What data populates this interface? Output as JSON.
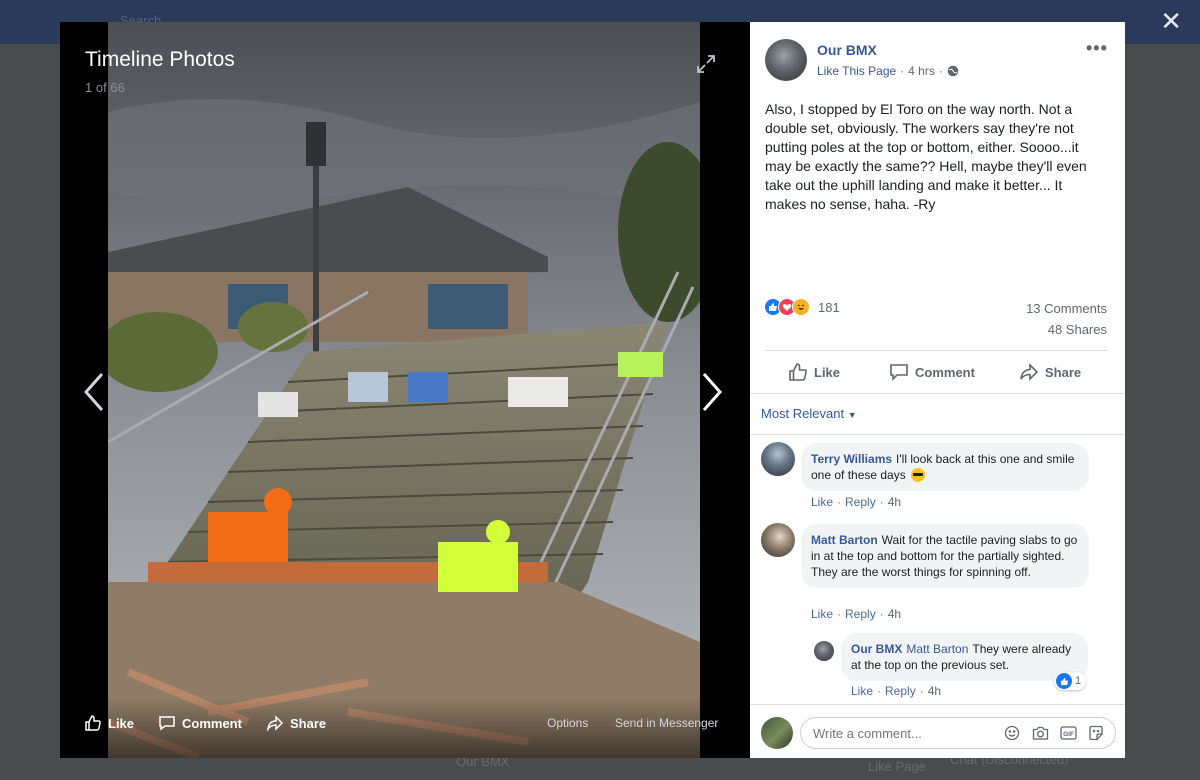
{
  "background": {
    "search_placeholder": "Search",
    "ghost_page_name": "Our BMX",
    "ghost_like_page": "Like Page",
    "ghost_chat": "Chat (Disconnected)"
  },
  "viewer": {
    "title": "Timeline Photos",
    "counter": "1 of 66",
    "actions": {
      "like": "Like",
      "comment": "Comment",
      "share": "Share"
    },
    "links": {
      "options": "Options",
      "send": "Send in Messenger"
    }
  },
  "post": {
    "page_name": "Our BMX",
    "like_page": "Like This Page",
    "separator": "·",
    "time": "4 hrs",
    "text": "Also, I stopped by El Toro on the way north. Not a double set, obviously. The workers say they're not putting poles at the top or bottom, either. Soooo...it may be exactly the same?? Hell, maybe they'll even take out the uphill landing and make it better... It makes no sense, haha. -Ry",
    "reaction_count": "181",
    "comments_count": "13 Comments",
    "shares_count": "48 Shares",
    "actions": {
      "like": "Like",
      "comment": "Comment",
      "share": "Share"
    }
  },
  "comments": {
    "sort_label": "Most Relevant",
    "items": [
      {
        "author": "Terry Williams",
        "text": "I'll look back at this one and smile one of these days",
        "like": "Like",
        "reply": "Reply",
        "time": "4h"
      },
      {
        "author": "Matt Barton",
        "text": "Wait for the tactile paving slabs to go in at the top and bottom for the partially sighted. They are the worst things for spinning off.",
        "like": "Like",
        "reply": "Reply",
        "time": "4h"
      }
    ],
    "reply": {
      "author": "Our BMX",
      "mention": "Matt Barton",
      "text": "They were already at the top on the previous set.",
      "like": "Like",
      "reply": "Reply",
      "time": "4h",
      "reaction_count": "1"
    }
  },
  "composer": {
    "placeholder": "Write a comment..."
  },
  "colors": {
    "link": "#365899",
    "facebook_blue": "#1877f2",
    "bubble": "#f2f3f5"
  }
}
